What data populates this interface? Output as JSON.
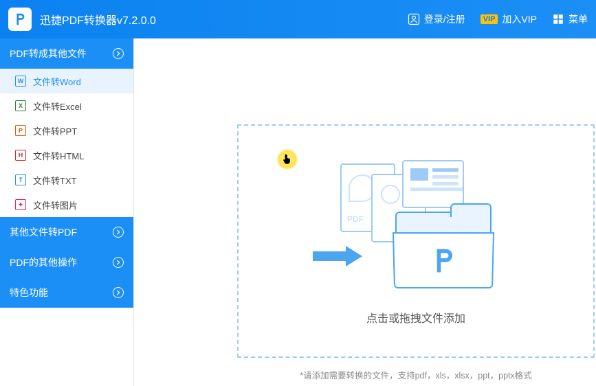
{
  "titlebar": {
    "app_title": "迅捷PDF转换器v7.2.0.0",
    "login": "登录/注册",
    "vip_badge": "VIP",
    "vip": "加入VIP",
    "menu": "菜单"
  },
  "sidebar": {
    "categories": [
      {
        "label": "PDF转成其他文件",
        "expanded": true
      },
      {
        "label": "其他文件转PDF",
        "expanded": false
      },
      {
        "label": "PDF的其他操作",
        "expanded": false
      },
      {
        "label": "特色功能",
        "expanded": false
      }
    ],
    "items": [
      {
        "label": "文件转Word",
        "icon": "W",
        "cls": "word",
        "active": true
      },
      {
        "label": "文件转Excel",
        "icon": "X",
        "cls": "excel",
        "active": false
      },
      {
        "label": "文件转PPT",
        "icon": "P",
        "cls": "ppt",
        "active": false
      },
      {
        "label": "文件转HTML",
        "icon": "H",
        "cls": "html",
        "active": false
      },
      {
        "label": "文件转TXT",
        "icon": "T",
        "cls": "txt",
        "active": false
      },
      {
        "label": "文件转图片",
        "icon": "✦",
        "cls": "img",
        "active": false
      }
    ]
  },
  "main": {
    "dropzone_text": "点击或拖拽文件添加",
    "hint": "*请添加需要转换的文件，支持pdf，xls，xlsx，ppt，pptx格式"
  }
}
